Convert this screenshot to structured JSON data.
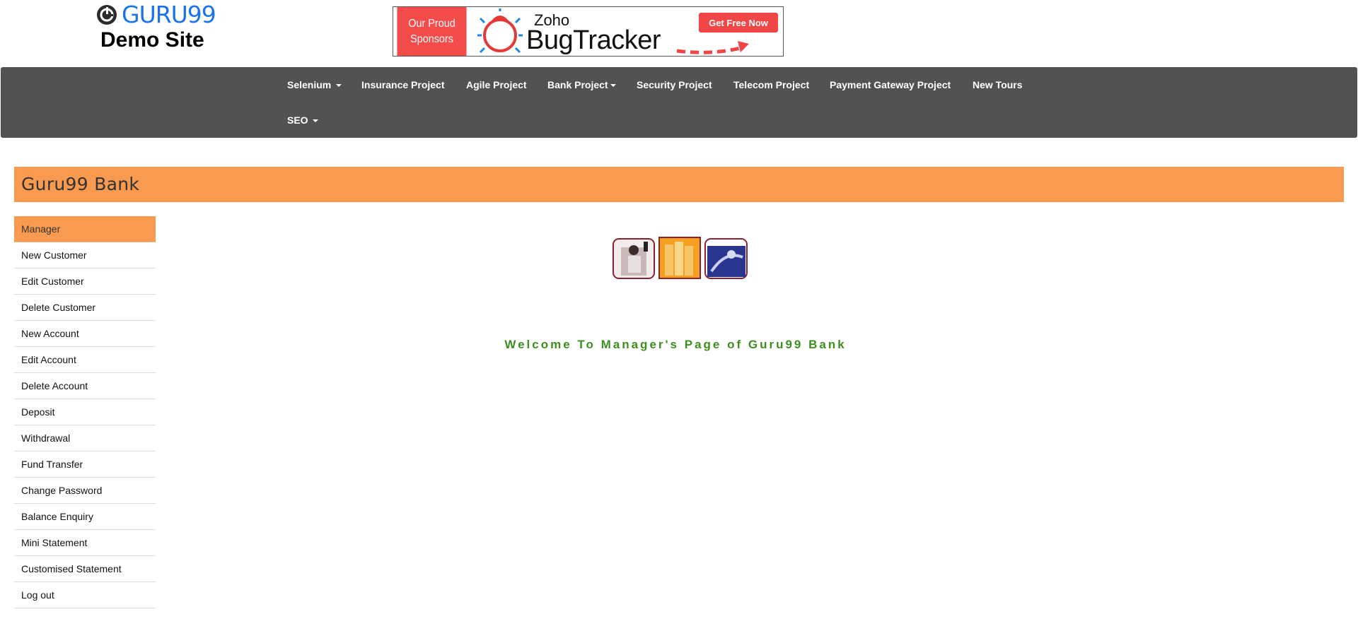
{
  "brand": {
    "name": "GURU99",
    "subtitle": "Demo Site"
  },
  "sponsor": {
    "label_line1": "Our Proud",
    "label_line2": "Sponsors",
    "vendor": "Zoho",
    "product": "BugTracker",
    "cta": "Get Free Now"
  },
  "nav": {
    "items": [
      {
        "label": "Selenium",
        "dropdown": true
      },
      {
        "label": "Insurance Project",
        "dropdown": false
      },
      {
        "label": "Agile Project",
        "dropdown": false
      },
      {
        "label": "Bank Project",
        "dropdown": true
      },
      {
        "label": "Security Project",
        "dropdown": false
      },
      {
        "label": "Telecom Project",
        "dropdown": false
      },
      {
        "label": "Payment Gateway Project",
        "dropdown": false
      },
      {
        "label": "New Tours",
        "dropdown": false
      },
      {
        "label": "SEO",
        "dropdown": true
      }
    ]
  },
  "bank": {
    "title": "Guru99 Bank"
  },
  "menu": {
    "active_index": 0,
    "items": [
      "Manager",
      "New Customer",
      "Edit Customer",
      "Delete Customer",
      "New Account",
      "Edit Account",
      "Delete Account",
      "Deposit",
      "Withdrawal",
      "Fund Transfer",
      "Change Password",
      "Balance Enquiry",
      "Mini Statement",
      "Customised Statement",
      "Log out"
    ]
  },
  "content": {
    "welcome": "Welcome To Manager's Page of Guru99 Bank"
  },
  "colors": {
    "accent_orange": "#f89a50",
    "navbar_gray": "#525252",
    "welcome_green": "#3c8f1e",
    "brand_blue": "#1a73e8",
    "sponsor_red": "#f44b4b"
  }
}
